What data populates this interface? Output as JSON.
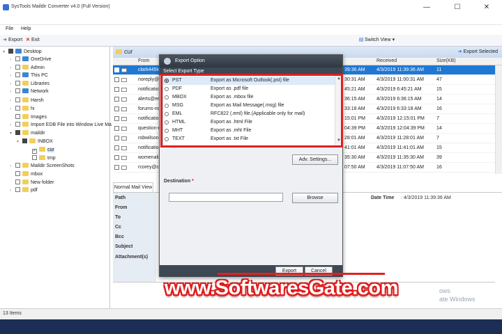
{
  "window": {
    "title": "SysTools Maildir Converter v4.0 (Full Version)",
    "minimize": "—",
    "maximize": "☐",
    "close": "✕"
  },
  "menu": {
    "file": "File",
    "help": "Help"
  },
  "toolbar": {
    "export": "Export",
    "exit": "Exit",
    "switch_view": "Switch View",
    "switch_arrow": "▾",
    "export_selected": "Export Selected"
  },
  "tree": [
    {
      "label": "Desktop",
      "exp": "▾",
      "cb": "partial",
      "folder": "blue"
    },
    {
      "label": "OneDrive",
      "exp": "›",
      "cb": "",
      "folder": "blue"
    },
    {
      "label": "Admin",
      "exp": "›",
      "cb": "",
      "folder": "yellow"
    },
    {
      "label": "This PC",
      "exp": "›",
      "cb": "",
      "folder": "blue"
    },
    {
      "label": "Libraries",
      "exp": "›",
      "cb": "",
      "folder": "yellow"
    },
    {
      "label": "Network",
      "exp": "›",
      "cb": "",
      "folder": "blue"
    },
    {
      "label": "Harsh",
      "exp": "›",
      "cb": "",
      "folder": "yellow"
    },
    {
      "label": "hi",
      "exp": "›",
      "cb": "",
      "folder": "yellow"
    },
    {
      "label": "Images",
      "exp": "",
      "cb": "",
      "folder": "yellow"
    },
    {
      "label": "Import EDB File into Window Live Ma",
      "exp": "›",
      "cb": "",
      "folder": "yellow"
    },
    {
      "label": "maildir",
      "exp": "▾",
      "cb": "partial",
      "folder": "yellow"
    },
    {
      "label": "INBOX",
      "exp": "▾",
      "cb": "partial",
      "folder": "yellow"
    },
    {
      "label": "cur",
      "exp": "",
      "cb": "checked",
      "folder": "yellow"
    },
    {
      "label": "tmp",
      "exp": "",
      "cb": "",
      "folder": "yellow"
    },
    {
      "label": "Maildir ScreenShots",
      "exp": "›",
      "cb": "",
      "folder": "yellow"
    },
    {
      "label": "mbox",
      "exp": "",
      "cb": "",
      "folder": "yellow"
    },
    {
      "label": "New folder",
      "exp": "",
      "cb": "",
      "folder": "yellow"
    },
    {
      "label": "pdf",
      "exp": "›",
      "cb": "",
      "folder": "yellow"
    }
  ],
  "path": "cur",
  "columns": {
    "from": "From",
    "received": "Received",
    "size": "Size(KB)"
  },
  "mails": [
    {
      "from": "clark445kent",
      "sent": "39:36 AM",
      "received": "4/3/2019 11:39:36 AM",
      "size": "11"
    },
    {
      "from": "noreply@p",
      "sent": "30:31 AM",
      "received": "4/3/2019 11:00:31 AM",
      "size": "47"
    },
    {
      "from": "notification",
      "sent": "45:21 AM",
      "received": "4/3/2019 6:45:21 AM",
      "size": "15"
    },
    {
      "from": "alerts@emu",
      "sent": "36:15 AM",
      "received": "4/3/2019 6:36:15 AM",
      "size": "14"
    },
    {
      "from": "forums-nor",
      "sent": "33:18 AM",
      "received": "4/3/2019 6:33:18 AM",
      "size": "16"
    },
    {
      "from": "notification",
      "sent": "15:01 PM",
      "received": "4/3/2019 12:15:01 PM",
      "size": "7"
    },
    {
      "from": "question-n",
      "sent": "04:39 PM",
      "received": "4/3/2019 12:04:39 PM",
      "size": "14"
    },
    {
      "from": "robwilson@",
      "sent": "28:01 AM",
      "received": "4/3/2019 11:28:01 AM",
      "size": "7"
    },
    {
      "from": "notification",
      "sent": "41:01 AM",
      "received": "4/3/2019 11:41:01 AM",
      "size": "15"
    },
    {
      "from": "womenalia",
      "sent": "35:30 AM",
      "received": "4/3/2019 11:35:30 AM",
      "size": "39"
    },
    {
      "from": "rcorey@cyb",
      "sent": "07:50 AM",
      "received": "4/3/2019 11:07:50 AM",
      "size": "16"
    }
  ],
  "preview": {
    "tab": "Normal Mail View",
    "labels": [
      "Path",
      "From",
      "To",
      "Cc",
      "Bcc",
      "Subject",
      "Attachment(s)"
    ],
    "colon": ":",
    "date_label": "Date Time",
    "date_value": ": 4/3/2019 11:39:36 AM"
  },
  "activate": {
    "line1": "ows",
    "line2": "ate Windows"
  },
  "status": "13 Items",
  "dialog": {
    "title": "Export Option",
    "section": "Select Export Type",
    "options": [
      {
        "name": "PST",
        "desc": "Export as Microsoft Outlook(.pst) file"
      },
      {
        "name": "PDF",
        "desc": "Export as .pdf file"
      },
      {
        "name": "MBOX",
        "desc": "Export as .mbox file"
      },
      {
        "name": "MSG",
        "desc": "Export as Mail Message(.msg) file"
      },
      {
        "name": "EML",
        "desc": "RFC822 (.eml) file.(Applicable only for mail)"
      },
      {
        "name": "HTML",
        "desc": "Export as .html File"
      },
      {
        "name": "MHT",
        "desc": "Export as .mht File"
      },
      {
        "name": "TEXT",
        "desc": "Export as .txt File"
      }
    ],
    "selected": "PST",
    "adv_settings": "Adv. Settings...",
    "destination_label": "Destination",
    "required_mark": "*",
    "destination_value": "",
    "browse": "Browse",
    "export": "Export",
    "cancel": "Cancel",
    "scroll_up": "▲",
    "scroll_down": "▼"
  },
  "watermark": "www.SoftwaresGate.com",
  "colors": {
    "accent": "#1e78d4",
    "highlight": "#e02020",
    "dialog_header": "#3d4853"
  }
}
